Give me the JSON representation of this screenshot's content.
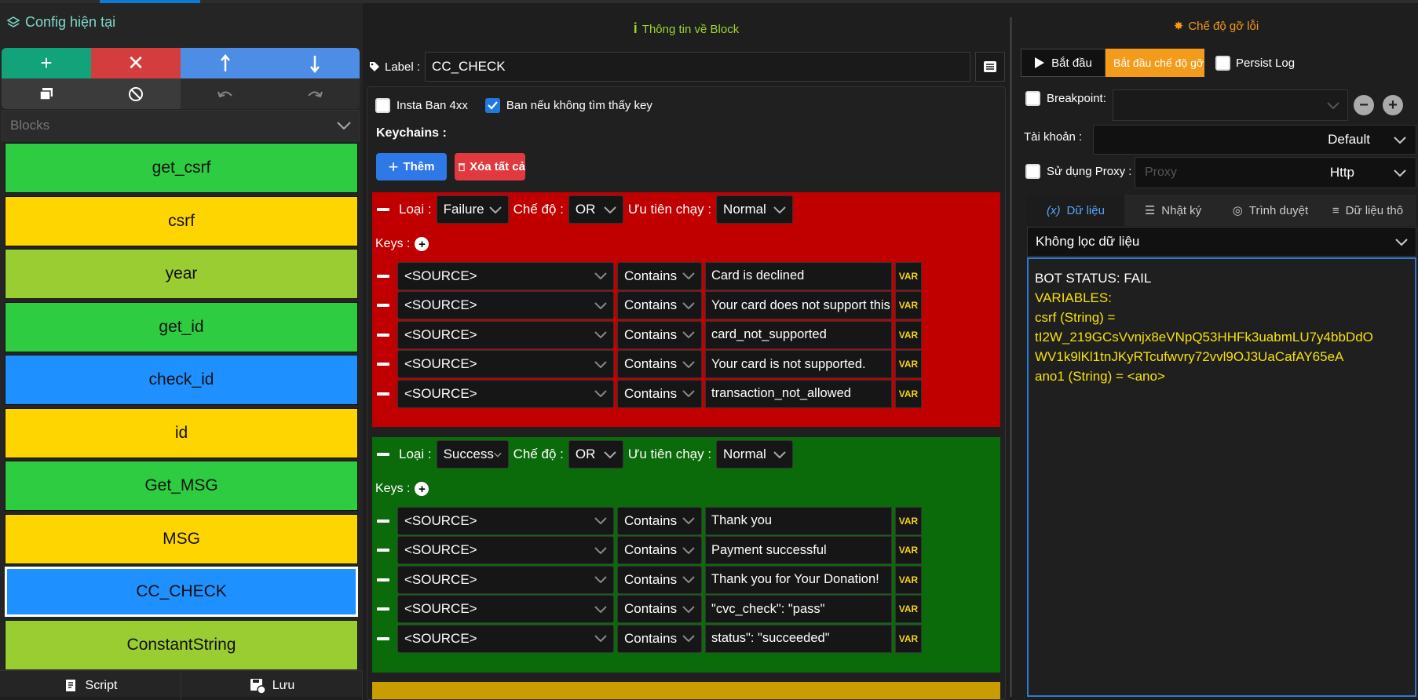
{
  "left": {
    "title": "Config hiện tại",
    "blocks_placeholder": "Blocks",
    "blocks": [
      {
        "label": "get_csrf",
        "color": "#2ecc40"
      },
      {
        "label": "csrf",
        "color": "#ffd500"
      },
      {
        "label": "year",
        "color": "#9acd32"
      },
      {
        "label": "get_id",
        "color": "#2ecc40"
      },
      {
        "label": "check_id",
        "color": "#1e90ff"
      },
      {
        "label": "id",
        "color": "#ffd500"
      },
      {
        "label": "Get_MSG",
        "color": "#2ecc40"
      },
      {
        "label": "MSG",
        "color": "#ffd500"
      },
      {
        "label": "CC_CHECK",
        "color": "#1e90ff"
      },
      {
        "label": "ConstantString",
        "color": "#9acd32"
      }
    ],
    "script_label": "Script",
    "save_label": "Lưu"
  },
  "mid": {
    "title": "Thông tin về Block",
    "label_caption": "Label :",
    "label_value": "CC_CHECK",
    "chk_insta": "Insta Ban 4xx",
    "chk_ban": "Ban nếu không tìm thấy key",
    "keychains_title": "Keychains :",
    "add_label": "Thêm",
    "clear_label": "Xóa tất cả",
    "type_caption": "Loại :",
    "mode_caption": "Chế độ :",
    "priority_caption": "Ưu tiên chạy :",
    "keys_caption": "Keys :",
    "var_label": "VAR",
    "red": {
      "type": "Failure",
      "mode": "OR",
      "priority": "Normal",
      "keys": [
        {
          "source": "<SOURCE>",
          "cond": "Contains",
          "value": "Card is declined"
        },
        {
          "source": "<SOURCE>",
          "cond": "Contains",
          "value": "Your card does not support this ty"
        },
        {
          "source": "<SOURCE>",
          "cond": "Contains",
          "value": "card_not_supported"
        },
        {
          "source": "<SOURCE>",
          "cond": "Contains",
          "value": "Your card is not supported."
        },
        {
          "source": "<SOURCE>",
          "cond": "Contains",
          "value": "transaction_not_allowed"
        }
      ]
    },
    "green": {
      "type": "Success",
      "mode": "OR",
      "priority": "Normal",
      "keys": [
        {
          "source": "<SOURCE>",
          "cond": "Contains",
          "value": "Thank you"
        },
        {
          "source": "<SOURCE>",
          "cond": "Contains",
          "value": "Payment successful"
        },
        {
          "source": "<SOURCE>",
          "cond": "Contains",
          "value": "Thank you for Your Donation!"
        },
        {
          "source": "<SOURCE>",
          "cond": "Contains",
          "value": "\"cvc_check\": \"pass\""
        },
        {
          "source": "<SOURCE>",
          "cond": "Contains",
          "value": "status\": \"succeeded\""
        }
      ]
    }
  },
  "right": {
    "title": "Chế độ gỡ lỗi",
    "start_label": "Bắt đầu",
    "debug_start_label": "Bắt đầu chế độ gỡ lỗi",
    "persist_label": "Persist Log",
    "breakpoint_label": "Breakpoint:",
    "account_label": "Tài khoản :",
    "account_value": "Default",
    "proxy_label": "Sử dụng Proxy :",
    "proxy_placeholder": "Proxy",
    "proxy_type": "Http",
    "tabs": [
      "Dữ liệu",
      "Nhật ký",
      "Trình duyệt",
      "Dữ liệu thô"
    ],
    "filter_value": "Không lọc dữ liệu",
    "output": [
      {
        "text": "BOT STATUS: FAIL",
        "color": "#ffffff"
      },
      {
        "text": "VARIABLES:",
        "color": "#f5e10a"
      },
      {
        "text": "csrf (String) =",
        "color": "#f5e10a"
      },
      {
        "text": "tI2W_219GCsVvnjx8eVNpQ53HHFk3uabmLU7y4bbDdO",
        "color": "#f5e10a"
      },
      {
        "text": "WV1k9lKl1tnJKyRTcufwvry72vvl9OJ3UaCafAY65eA",
        "color": "#f5e10a"
      },
      {
        "text": "ano1 (String) = <ano>",
        "color": "#f5e10a"
      }
    ],
    "accent": "#2f7ad0"
  }
}
